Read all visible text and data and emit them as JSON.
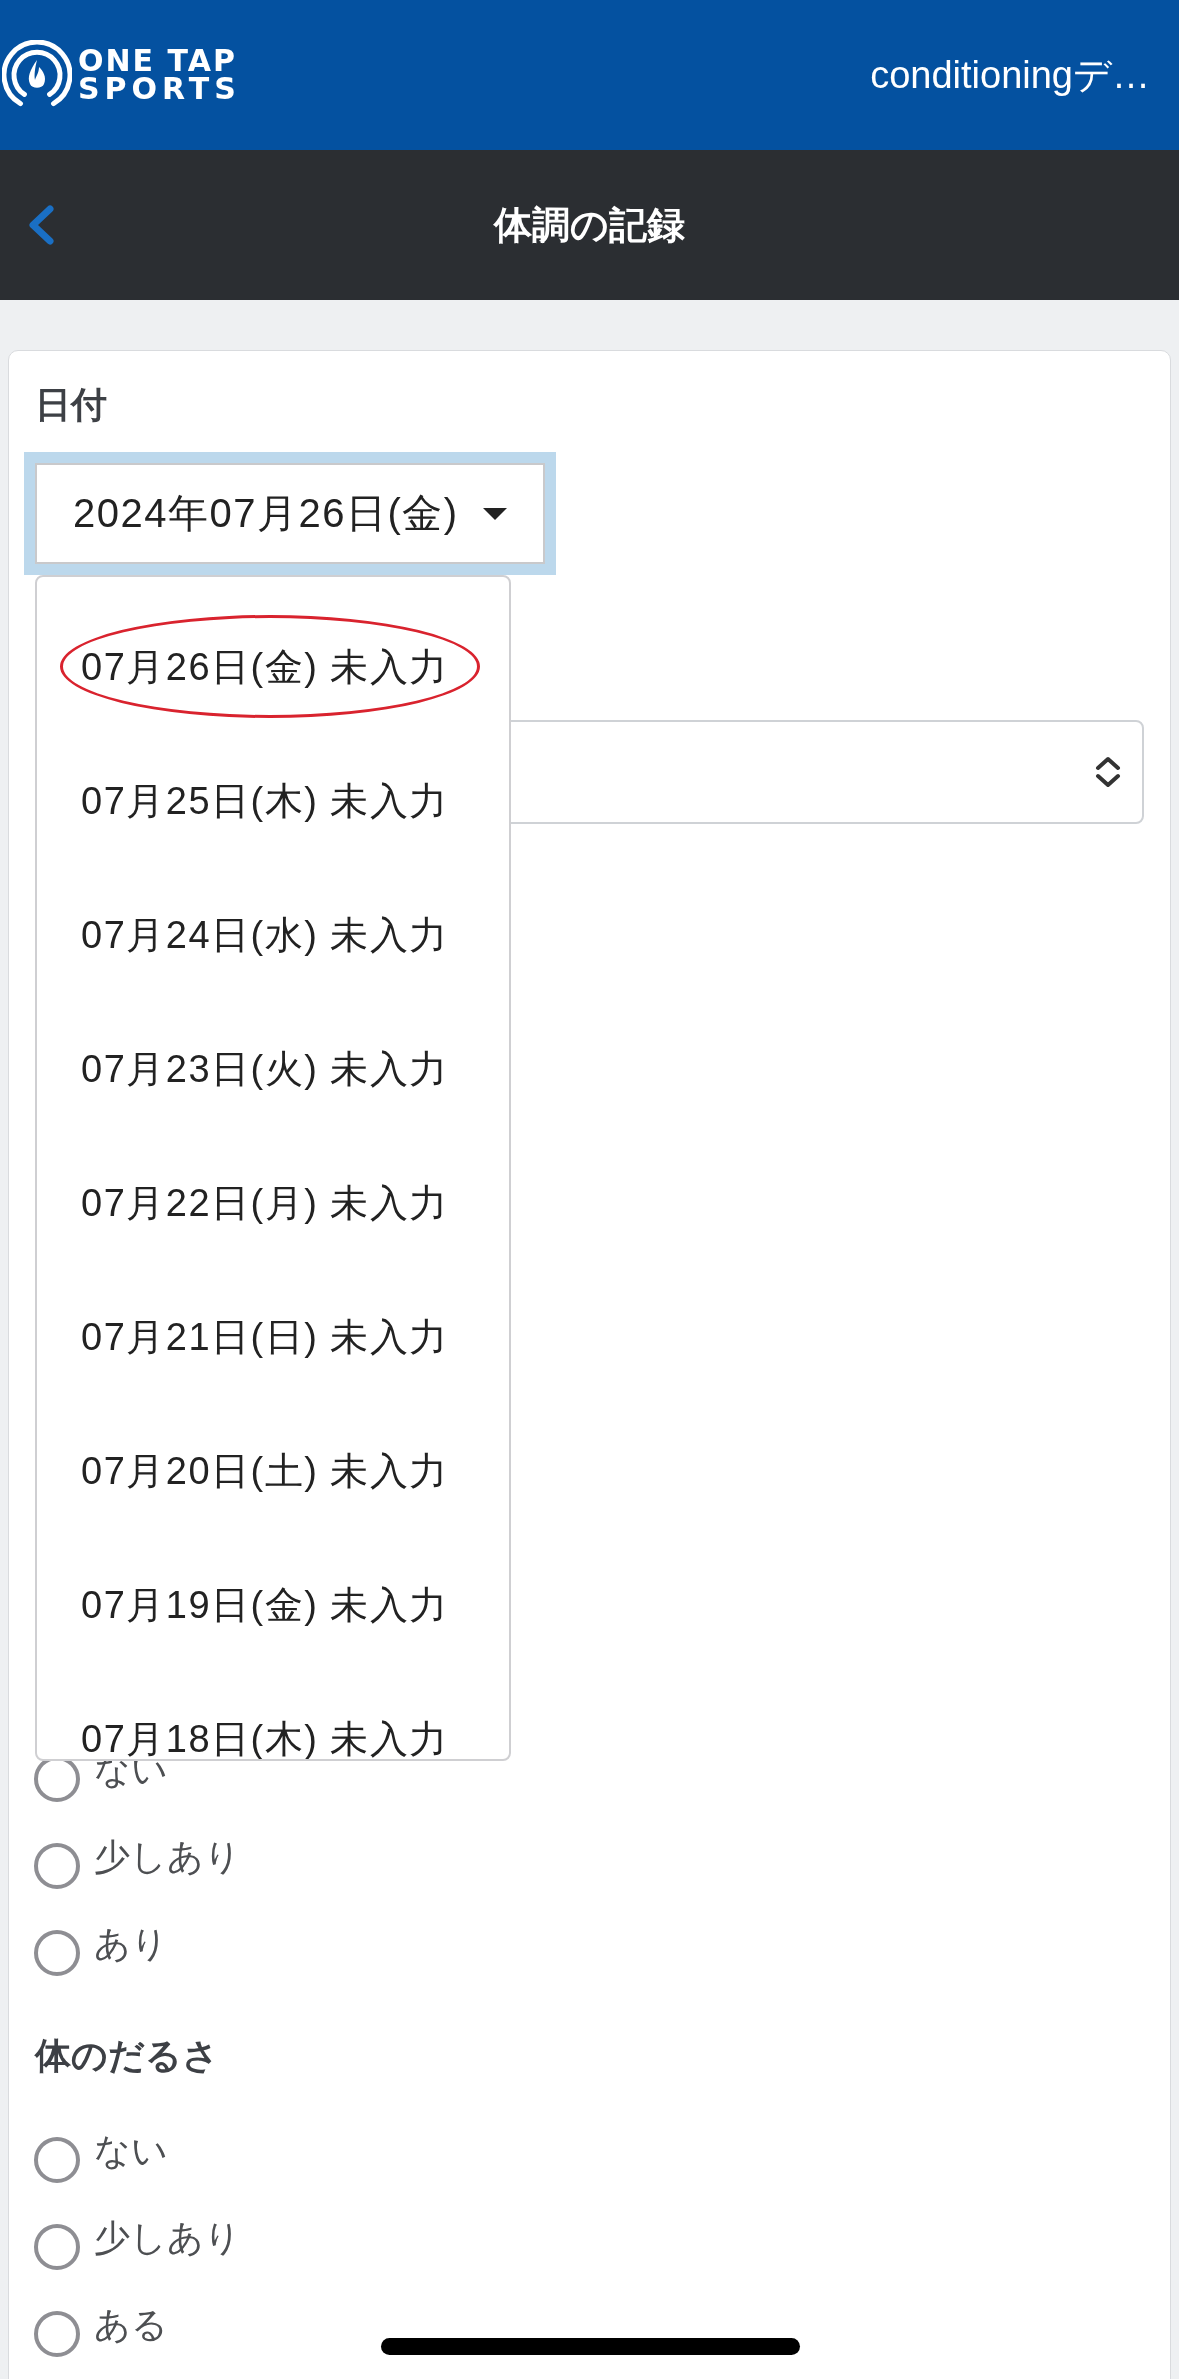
{
  "header": {
    "logo": {
      "lines": [
        "ONE TAP",
        "SPORTS"
      ]
    },
    "title": "conditioningデ…"
  },
  "nav_bar": {
    "title": "体調の記録"
  },
  "form": {
    "date_field": {
      "label": "日付",
      "value": "2024年07月26日(金)",
      "focused": true,
      "expanded": true
    },
    "date_options": [
      {
        "label": "07月26日(金) 未入力",
        "circled": true
      },
      {
        "label": "07月25日(木) 未入力",
        "circled": false
      },
      {
        "label": "07月24日(水) 未入力",
        "circled": false
      },
      {
        "label": "07月23日(火) 未入力",
        "circled": false
      },
      {
        "label": "07月22日(月) 未入力",
        "circled": false
      },
      {
        "label": "07月21日(日) 未入力",
        "circled": false
      },
      {
        "label": "07月20日(土) 未入力",
        "circled": false
      },
      {
        "label": "07月19日(金) 未入力",
        "circled": false
      },
      {
        "label": "07月18日(木) 未入力",
        "circled": false
      }
    ],
    "sections": [
      {
        "kind": "select"
      },
      {
        "kind": "radio_group",
        "options": [
          {
            "label": "ない",
            "selected": false
          },
          {
            "label": "少しあり",
            "selected": false
          },
          {
            "label": "あり",
            "selected": false
          }
        ]
      },
      {
        "kind": "radio_group",
        "heading": "体のだるさ",
        "options": [
          {
            "label": "ない",
            "selected": false
          },
          {
            "label": "少しあり",
            "selected": false
          },
          {
            "label": "ある",
            "selected": false
          }
        ]
      }
    ]
  }
}
